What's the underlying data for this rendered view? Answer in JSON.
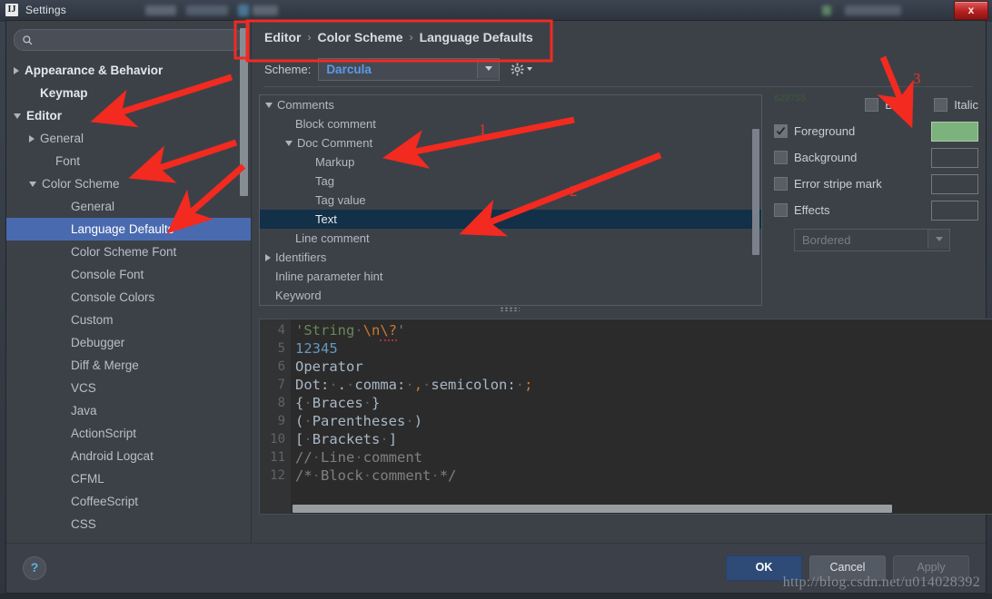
{
  "window": {
    "title": "Settings",
    "app_icon": "intellij-idea-icon",
    "close_label": "x"
  },
  "search": {
    "value": "",
    "placeholder": "",
    "icon": "search-icon"
  },
  "sidebar": {
    "items": [
      {
        "label": "Appearance & Behavior",
        "indent": 0,
        "arrow": "right",
        "bold": true,
        "selected": false
      },
      {
        "label": "Keymap",
        "indent": 1,
        "arrow": "none",
        "bold": true,
        "selected": false
      },
      {
        "label": "Editor",
        "indent": 0,
        "arrow": "down",
        "bold": true,
        "selected": false
      },
      {
        "label": "General",
        "indent": 1,
        "arrow": "right",
        "bold": false,
        "selected": false
      },
      {
        "label": "Font",
        "indent": 2,
        "arrow": "none",
        "bold": false,
        "selected": false
      },
      {
        "label": "Color Scheme",
        "indent": 1,
        "arrow": "down",
        "bold": false,
        "selected": false
      },
      {
        "label": "General",
        "indent": 3,
        "arrow": "none",
        "bold": false,
        "selected": false
      },
      {
        "label": "Language Defaults",
        "indent": 3,
        "arrow": "none",
        "bold": false,
        "selected": true
      },
      {
        "label": "Color Scheme Font",
        "indent": 3,
        "arrow": "none",
        "bold": false,
        "selected": false
      },
      {
        "label": "Console Font",
        "indent": 3,
        "arrow": "none",
        "bold": false,
        "selected": false
      },
      {
        "label": "Console Colors",
        "indent": 3,
        "arrow": "none",
        "bold": false,
        "selected": false
      },
      {
        "label": "Custom",
        "indent": 3,
        "arrow": "none",
        "bold": false,
        "selected": false
      },
      {
        "label": "Debugger",
        "indent": 3,
        "arrow": "none",
        "bold": false,
        "selected": false
      },
      {
        "label": "Diff & Merge",
        "indent": 3,
        "arrow": "none",
        "bold": false,
        "selected": false
      },
      {
        "label": "VCS",
        "indent": 3,
        "arrow": "none",
        "bold": false,
        "selected": false
      },
      {
        "label": "Java",
        "indent": 3,
        "arrow": "none",
        "bold": false,
        "selected": false
      },
      {
        "label": "ActionScript",
        "indent": 3,
        "arrow": "none",
        "bold": false,
        "selected": false
      },
      {
        "label": "Android Logcat",
        "indent": 3,
        "arrow": "none",
        "bold": false,
        "selected": false
      },
      {
        "label": "CFML",
        "indent": 3,
        "arrow": "none",
        "bold": false,
        "selected": false
      },
      {
        "label": "CoffeeScript",
        "indent": 3,
        "arrow": "none",
        "bold": false,
        "selected": false
      },
      {
        "label": "CSS",
        "indent": 3,
        "arrow": "none",
        "bold": false,
        "selected": false
      }
    ]
  },
  "breadcrumb": {
    "parts": [
      "Editor",
      "Color Scheme",
      "Language Defaults"
    ],
    "separator": "›"
  },
  "scheme": {
    "label": "Scheme:",
    "value": "Darcula",
    "dropdown_icon": "chevron-down-icon",
    "gear_icon": "gear-icon"
  },
  "attribute_list": {
    "rows": [
      {
        "label": "Comments",
        "indent": 0,
        "arrow": "down",
        "selected": false
      },
      {
        "label": "Block comment",
        "indent": 1,
        "arrow": "none",
        "selected": false
      },
      {
        "label": "Doc Comment",
        "indent": 1,
        "arrow": "down",
        "selected": false
      },
      {
        "label": "Markup",
        "indent": 2,
        "arrow": "none",
        "selected": false
      },
      {
        "label": "Tag",
        "indent": 2,
        "arrow": "none",
        "selected": false
      },
      {
        "label": "Tag value",
        "indent": 2,
        "arrow": "none",
        "selected": false
      },
      {
        "label": "Text",
        "indent": 2,
        "arrow": "none",
        "selected": true
      },
      {
        "label": "Line comment",
        "indent": 1,
        "arrow": "none",
        "selected": false
      },
      {
        "label": "Identifiers",
        "indent": 0,
        "arrow": "right",
        "selected": false
      },
      {
        "label": "Inline parameter hint",
        "indent": 0,
        "arrow": "none",
        "selected": false
      },
      {
        "label": "Keyword",
        "indent": 0,
        "arrow": "none",
        "selected": false
      }
    ]
  },
  "properties": {
    "bold": {
      "label": "Bold",
      "checked": false
    },
    "italic": {
      "label": "Italic",
      "checked": false
    },
    "rows": [
      {
        "label": "Foreground",
        "checked": true,
        "color": "629755",
        "has_color": true
      },
      {
        "label": "Background",
        "checked": false,
        "color": "",
        "has_color": false
      },
      {
        "label": "Error stripe mark",
        "checked": false,
        "color": "",
        "has_color": false
      },
      {
        "label": "Effects",
        "checked": false,
        "color": "",
        "has_color": false
      }
    ],
    "effects_combo": {
      "value": "Bordered",
      "enabled": false,
      "dropdown_icon": "chevron-down-icon"
    },
    "foreground_swatch_bg": "#7cb37c"
  },
  "preview": {
    "inspection_icon": "inspection-ok-checkmark",
    "lines": [
      {
        "no": "4",
        "tokens": [
          {
            "t": "'String",
            "c": "str"
          },
          {
            "t": " ",
            "c": "dot"
          },
          {
            "t": "\\n",
            "c": "esc"
          },
          {
            "t": "\\?",
            "c": "esc-err"
          },
          {
            "t": "'",
            "c": "str"
          }
        ]
      },
      {
        "no": "5",
        "tokens": [
          {
            "t": "12345",
            "c": "num"
          }
        ]
      },
      {
        "no": "6",
        "tokens": [
          {
            "t": "Operator",
            "c": "txt"
          }
        ]
      },
      {
        "no": "7",
        "tokens": [
          {
            "t": "Dot:",
            "c": "txt"
          },
          {
            "t": " ",
            "c": "dot"
          },
          {
            "t": ".",
            "c": "txt"
          },
          {
            "t": " ",
            "c": "dot"
          },
          {
            "t": "comma:",
            "c": "txt"
          },
          {
            "t": " ",
            "c": "dot"
          },
          {
            "t": ",",
            "c": "esc"
          },
          {
            "t": " ",
            "c": "dot"
          },
          {
            "t": "semicolon:",
            "c": "txt"
          },
          {
            "t": " ",
            "c": "dot"
          },
          {
            "t": ";",
            "c": "esc"
          }
        ]
      },
      {
        "no": "8",
        "tokens": [
          {
            "t": "{",
            "c": "txt"
          },
          {
            "t": " ",
            "c": "dot"
          },
          {
            "t": "Braces",
            "c": "txt"
          },
          {
            "t": " ",
            "c": "dot"
          },
          {
            "t": "}",
            "c": "txt"
          }
        ]
      },
      {
        "no": "9",
        "tokens": [
          {
            "t": "(",
            "c": "txt"
          },
          {
            "t": " ",
            "c": "dot"
          },
          {
            "t": "Parentheses",
            "c": "txt"
          },
          {
            "t": " ",
            "c": "dot"
          },
          {
            "t": ")",
            "c": "txt"
          }
        ]
      },
      {
        "no": "10",
        "tokens": [
          {
            "t": "[",
            "c": "txt"
          },
          {
            "t": " ",
            "c": "dot"
          },
          {
            "t": "Brackets",
            "c": "txt"
          },
          {
            "t": " ",
            "c": "dot"
          },
          {
            "t": "]",
            "c": "txt"
          }
        ]
      },
      {
        "no": "11",
        "tokens": [
          {
            "t": "//",
            "c": "cm"
          },
          {
            "t": " ",
            "c": "dot"
          },
          {
            "t": "Line",
            "c": "cm"
          },
          {
            "t": " ",
            "c": "dot"
          },
          {
            "t": "comment",
            "c": "cm"
          }
        ]
      },
      {
        "no": "12",
        "tokens": [
          {
            "t": "/*",
            "c": "cm"
          },
          {
            "t": " ",
            "c": "dot"
          },
          {
            "t": "Block",
            "c": "cm"
          },
          {
            "t": " ",
            "c": "dot"
          },
          {
            "t": "comment",
            "c": "cm"
          },
          {
            "t": " ",
            "c": "dot"
          },
          {
            "t": "*/",
            "c": "cm"
          }
        ]
      }
    ]
  },
  "footer": {
    "help_label": "?",
    "ok_label": "OK",
    "cancel_label": "Cancel",
    "apply_label": "Apply"
  },
  "watermark": "http://blog.csdn.net/u014028392",
  "annotations": {
    "numbers": [
      "1",
      "2",
      "3"
    ],
    "color": "#f22a20"
  }
}
